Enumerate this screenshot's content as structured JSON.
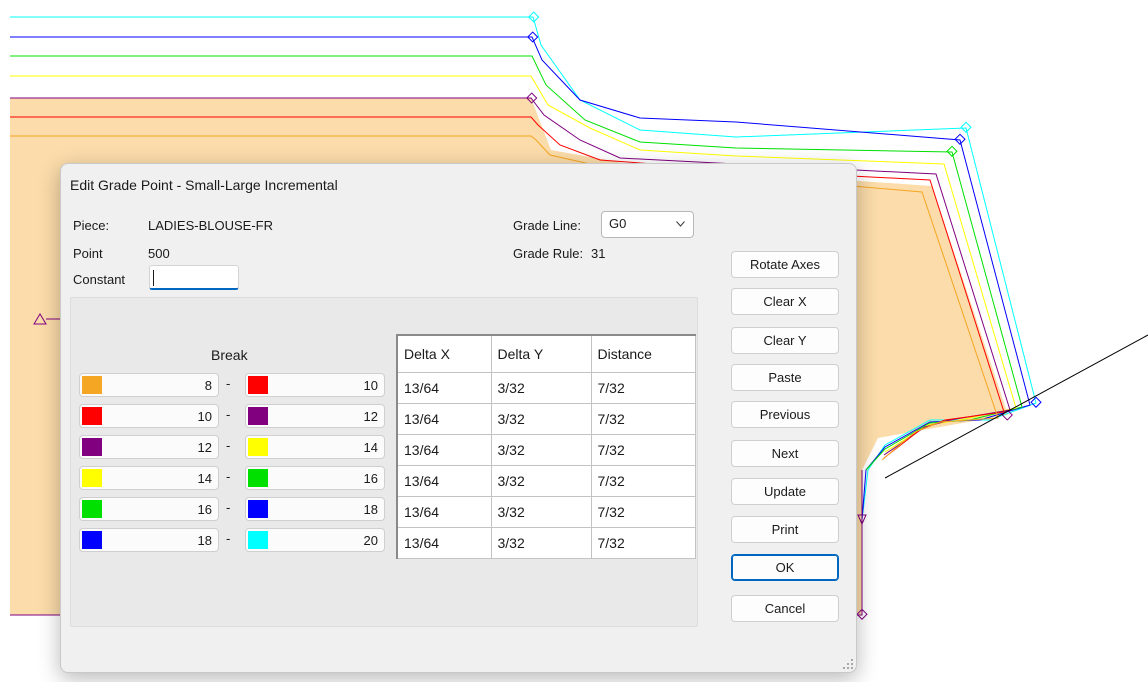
{
  "dialog": {
    "title": "Edit Grade Point - Small-Large Incremental",
    "piece_label": "Piece:",
    "piece_value": "LADIES-BLOUSE-FR",
    "point_label": "Point",
    "point_value": "500",
    "constant_label": "Constant",
    "constant_value": "",
    "grade_line_label": "Grade Line:",
    "grade_line_value": "G0",
    "grade_rule_label": "Grade Rule:",
    "grade_rule_value": "31",
    "break_label": "Break"
  },
  "breaks": [
    {
      "from": "8",
      "from_color": "#f5a623",
      "to": "10",
      "to_color": "#ff0000"
    },
    {
      "from": "10",
      "from_color": "#ff0000",
      "to": "12",
      "to_color": "#800080"
    },
    {
      "from": "12",
      "from_color": "#800080",
      "to": "14",
      "to_color": "#ffff00"
    },
    {
      "from": "14",
      "from_color": "#ffff00",
      "to": "16",
      "to_color": "#00e000"
    },
    {
      "from": "16",
      "from_color": "#00e000",
      "to": "18",
      "to_color": "#0000ff"
    },
    {
      "from": "18",
      "from_color": "#0000ff",
      "to": "20",
      "to_color": "#00ffff"
    }
  ],
  "break_separator": "-",
  "table": {
    "headers": [
      "Delta X",
      "Delta Y",
      "Distance"
    ],
    "rows": [
      [
        "13/64",
        "3/32",
        "7/32"
      ],
      [
        "13/64",
        "3/32",
        "7/32"
      ],
      [
        "13/64",
        "3/32",
        "7/32"
      ],
      [
        "13/64",
        "3/32",
        "7/32"
      ],
      [
        "13/64",
        "3/32",
        "7/32"
      ],
      [
        "13/64",
        "3/32",
        "7/32"
      ]
    ]
  },
  "buttons": {
    "rotate_axes": "Rotate Axes",
    "clear_x": "Clear X",
    "clear_y": "Clear Y",
    "paste": "Paste",
    "previous": "Previous",
    "next": "Next",
    "update": "Update",
    "print": "Print",
    "ok": "OK",
    "cancel": "Cancel"
  },
  "colors": {
    "piece_fill": "#fbdcaa",
    "accent": "#0067c0"
  }
}
